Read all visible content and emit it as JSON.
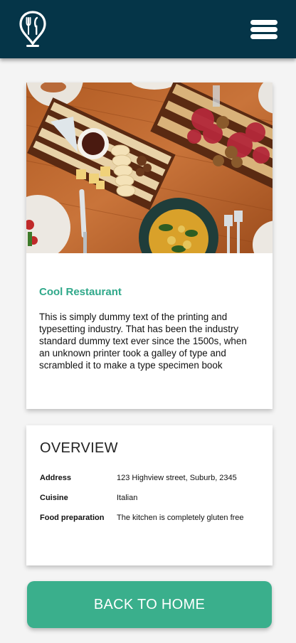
{
  "header": {
    "logo_icon": "fork-knife-pin-icon",
    "menu_icon": "hamburger-menu-icon",
    "background_color": "#053548"
  },
  "restaurant": {
    "image_icon": "food-platter-photo",
    "name": "Cool Restaurant",
    "description": "This is simply dummy text of the printing and typesetting industry. That has been the industry standard dummy text ever since the 1500s, when an unknown printer took a galley of type and scrambled it to make a type specimen book"
  },
  "overview": {
    "title": "OVERVIEW",
    "rows": [
      {
        "label": "Address",
        "value": "123 Highview street, Suburb, 2345"
      },
      {
        "label": "Cuisine",
        "value": "Italian"
      },
      {
        "label": "Food preparation",
        "value": "The kitchen is completely gluten free"
      }
    ]
  },
  "actions": {
    "back_label": "BACK TO HOME",
    "accent_color": "#3aaf8c"
  }
}
